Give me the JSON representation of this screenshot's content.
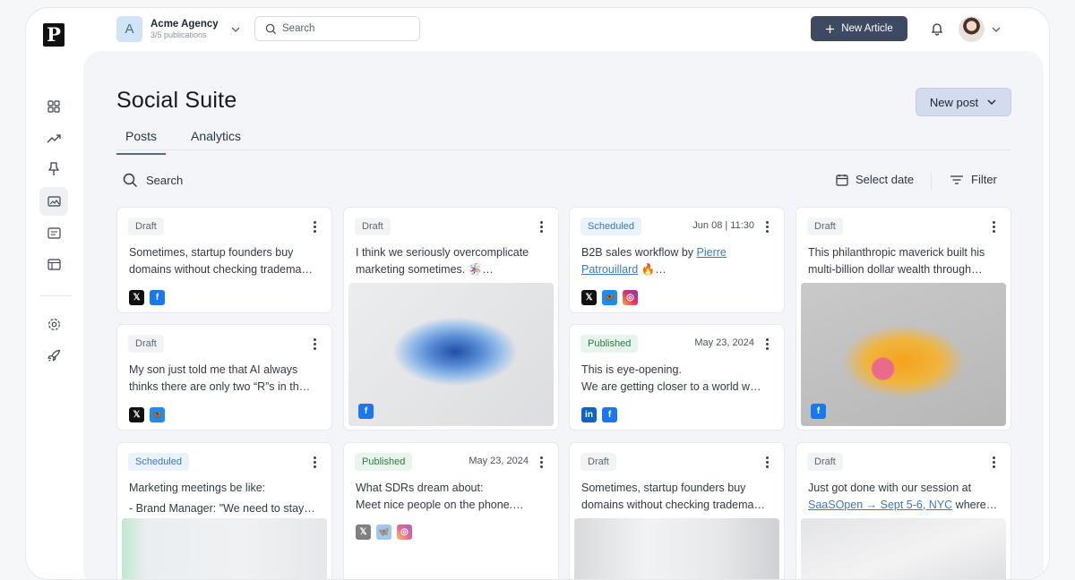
{
  "brand": {
    "logo_letter": "P"
  },
  "account": {
    "initial": "A",
    "name": "Acme Agency",
    "sub": "3/5 publications"
  },
  "top_search": {
    "placeholder": "Search"
  },
  "new_article": "New Article",
  "sidebar": [
    "dashboard",
    "analytics",
    "pin",
    "social-suite",
    "articles",
    "layout",
    "settings",
    "launch"
  ],
  "page": {
    "title": "Social Suite",
    "new_post": "New post"
  },
  "tabs": [
    "Posts",
    "Analytics"
  ],
  "toolbar": {
    "search": "Search",
    "select_date": "Select date",
    "filter": "Filter"
  },
  "cards": [
    {
      "status": "Draft",
      "date": "",
      "lines": [
        "Sometimes, startup founders buy",
        "domains without checking tradema…"
      ],
      "socials": [
        "x",
        "facebook"
      ]
    },
    {
      "status": "Draft",
      "date": "",
      "lines": [
        "My son just told me that AI always",
        "thinks there are only two “R”s in th…"
      ],
      "socials": [
        "x",
        "bluesky"
      ]
    },
    {
      "status": "Scheduled",
      "date": "",
      "lines": [
        "Marketing meetings be like:",
        "- Brand Manager: \"We need to stay…"
      ],
      "socials": []
    },
    {
      "status": "Draft",
      "date": "",
      "lines": [
        "I think we seriously overcomplicate",
        "marketing sometimes. 🪅…"
      ],
      "socials": [
        "facebook"
      ]
    },
    {
      "status": "Published",
      "date": "May 23, 2024",
      "lines": [
        "What SDRs dream about:",
        "Meet nice people on the phone.…"
      ],
      "socials": [
        "x",
        "bluesky",
        "instagram"
      ]
    },
    {
      "status": "Scheduled",
      "date": "Jun 08 | 11:30",
      "lines": [
        "B2B sales workflow by ",
        "Patrouillard 🔥…"
      ],
      "link1": "Pierre",
      "link2": "Patrouillard",
      "socials": [
        "x",
        "bluesky",
        "instagram"
      ]
    },
    {
      "status": "Published",
      "date": "May 23, 2024",
      "lines": [
        "This is eye-opening.",
        "We are getting closer to a world w…"
      ],
      "socials": [
        "linkedin",
        "facebook"
      ]
    },
    {
      "status": "Draft",
      "date": "",
      "lines": [
        "Sometimes, startup founders buy",
        "domains without checking tradema…"
      ],
      "socials": []
    },
    {
      "status": "Draft",
      "date": "",
      "lines": [
        "This philanthropic maverick built his",
        "multi-billion dollar wealth through…"
      ],
      "socials": [
        "facebook"
      ]
    },
    {
      "status": "Draft",
      "date": "",
      "lines": [
        "Just got done with our session at",
        " where…"
      ],
      "link": "SaaSOpen → Sept 5-6, NYC",
      "socials": []
    }
  ],
  "colors": {
    "primary_button": "#3d4a61",
    "scheduled": "#3b79c4",
    "published": "#2f7a48"
  }
}
